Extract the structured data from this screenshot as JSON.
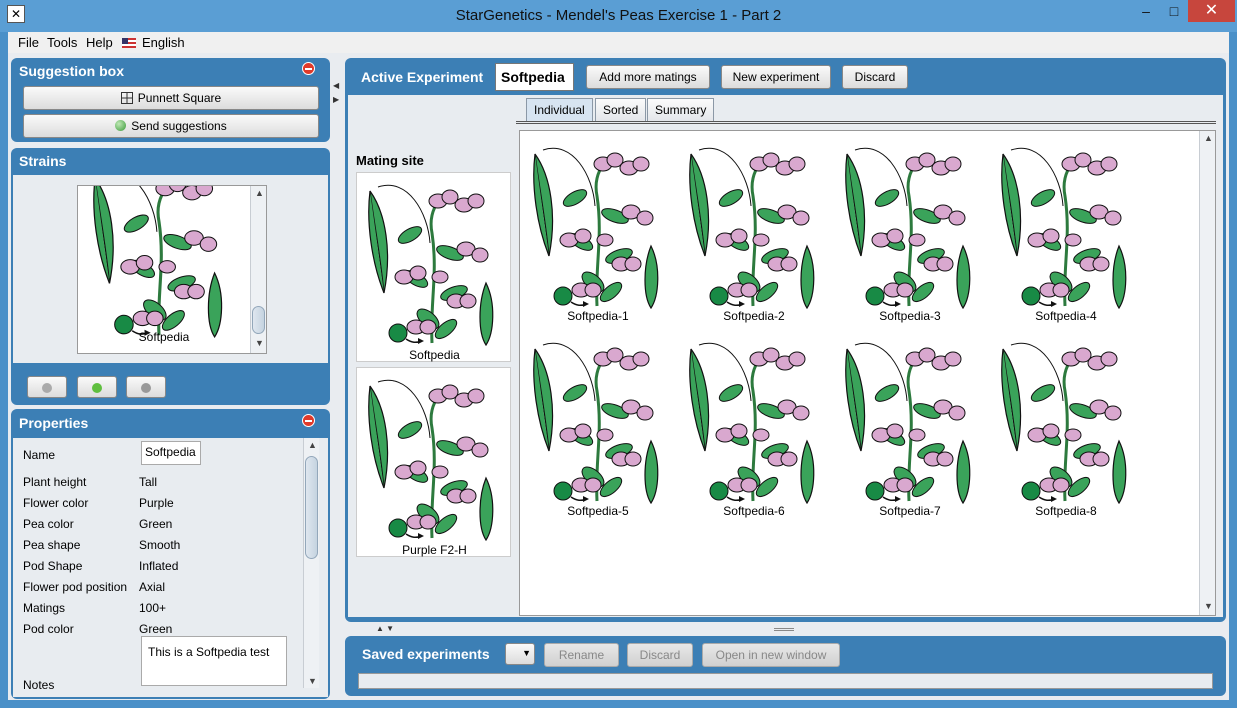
{
  "window": {
    "title": "StarGenetics - Mendel's Peas Exercise 1 - Part 2"
  },
  "menu": {
    "file": "File",
    "tools": "Tools",
    "help": "Help",
    "language": "English"
  },
  "suggestion_box": {
    "title": "Suggestion box",
    "punnett_label": "Punnett Square",
    "send_label": "Send suggestions"
  },
  "strains": {
    "title": "Strains",
    "items": [
      {
        "caption": "Softpedia"
      }
    ]
  },
  "properties": {
    "title": "Properties",
    "name_label": "Name",
    "name_value": "Softpedia",
    "rows": [
      {
        "label": "Plant height",
        "value": "Tall"
      },
      {
        "label": "Flower color",
        "value": "Purple"
      },
      {
        "label": "Pea color",
        "value": "Green"
      },
      {
        "label": "Pea shape",
        "value": "Smooth"
      },
      {
        "label": "Pod Shape",
        "value": "Inflated"
      },
      {
        "label": "Flower pod position",
        "value": "Axial"
      },
      {
        "label": "Matings",
        "value": "100+"
      },
      {
        "label": "Pod color",
        "value": "Green"
      }
    ],
    "notes_label": "Notes",
    "notes_value": "This is a Softpedia test"
  },
  "active_experiment": {
    "title": "Active Experiment",
    "name": "Softpedia",
    "add_matings_label": "Add more matings",
    "new_experiment_label": "New experiment",
    "discard_label": "Discard",
    "mating_site_label": "Mating site",
    "parents": [
      "Softpedia",
      "Purple F2-H"
    ],
    "tabs": [
      "Individual",
      "Sorted",
      "Summary"
    ],
    "offspring": [
      "Softpedia-1",
      "Softpedia-2",
      "Softpedia-3",
      "Softpedia-4",
      "Softpedia-5",
      "Softpedia-6",
      "Softpedia-7",
      "Softpedia-8"
    ]
  },
  "saved_experiments": {
    "title": "Saved experiments",
    "rename_label": "Rename",
    "discard_label": "Discard",
    "open_label": "Open in new window"
  },
  "colors": {
    "panel": "#3c7fb5",
    "pea_green": "#3aa35a",
    "flower": "#d9a8cf"
  }
}
